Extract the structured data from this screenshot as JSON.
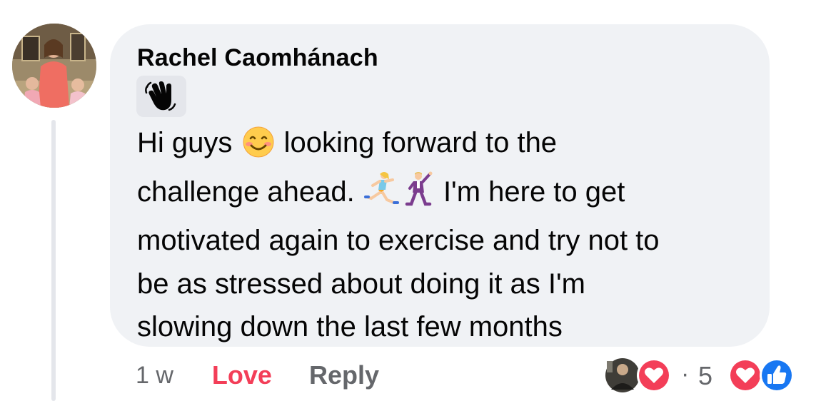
{
  "comment": {
    "author": "Rachel Caomhánach",
    "badge_icon": "waving-hand-icon",
    "lines": [
      {
        "before": "Hi guys ",
        "emoji": "smiling-face-icon",
        "after": " looking forward to the"
      },
      {
        "before": "challenge ahead. ",
        "emoji": "woman-running-icon",
        "emoji2": "man-dancing-icon",
        "after": " I'm here to get"
      },
      {
        "before": "motivated again to exercise and try not to"
      },
      {
        "before": "be as stressed about doing it as I'm"
      },
      {
        "before": "slowing down the last few months"
      }
    ]
  },
  "actions": {
    "time": "1 w",
    "love_label": "Love",
    "reply_label": "Reply"
  },
  "reactions": {
    "reply_reaction_icons": [
      "avatar",
      "love-reaction-icon"
    ],
    "separator": "·",
    "count": "5",
    "comment_reaction_icons": [
      "love-reaction-icon",
      "like-reaction-icon"
    ]
  },
  "colors": {
    "bubble": "#f0f2f5",
    "love": "#f33e58",
    "like": "#1877f2",
    "muted": "#65676b"
  }
}
